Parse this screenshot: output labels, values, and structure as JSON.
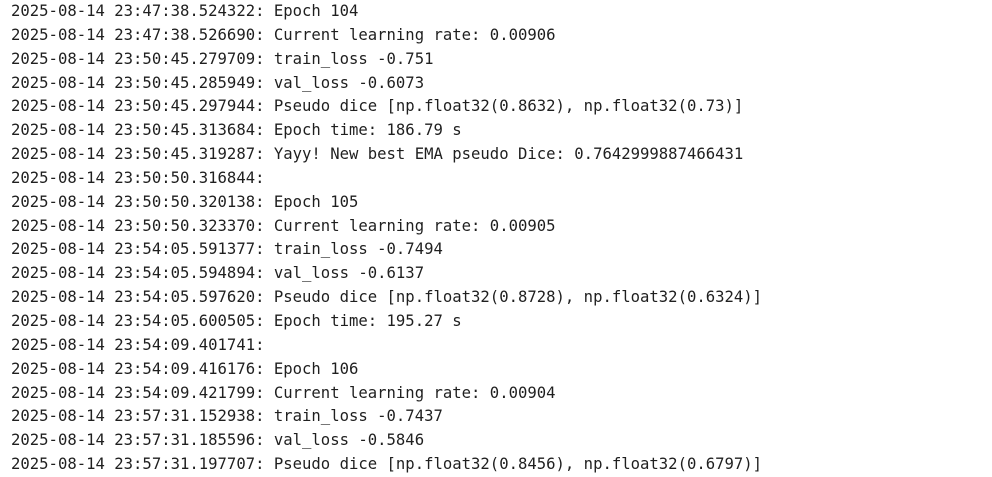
{
  "log": {
    "lines": [
      "2025-08-14 23:47:38.524322: Epoch 104",
      "2025-08-14 23:47:38.526690: Current learning rate: 0.00906",
      "2025-08-14 23:50:45.279709: train_loss -0.751",
      "2025-08-14 23:50:45.285949: val_loss -0.6073",
      "2025-08-14 23:50:45.297944: Pseudo dice [np.float32(0.8632), np.float32(0.73)]",
      "2025-08-14 23:50:45.313684: Epoch time: 186.79 s",
      "2025-08-14 23:50:45.319287: Yayy! New best EMA pseudo Dice: 0.7642999887466431",
      "2025-08-14 23:50:50.316844: ",
      "2025-08-14 23:50:50.320138: Epoch 105",
      "2025-08-14 23:50:50.323370: Current learning rate: 0.00905",
      "2025-08-14 23:54:05.591377: train_loss -0.7494",
      "2025-08-14 23:54:05.594894: val_loss -0.6137",
      "2025-08-14 23:54:05.597620: Pseudo dice [np.float32(0.8728), np.float32(0.6324)]",
      "2025-08-14 23:54:05.600505: Epoch time: 195.27 s",
      "2025-08-14 23:54:09.401741: ",
      "2025-08-14 23:54:09.416176: Epoch 106",
      "2025-08-14 23:54:09.421799: Current learning rate: 0.00904",
      "2025-08-14 23:57:31.152938: train_loss -0.7437",
      "2025-08-14 23:57:31.185596: val_loss -0.5846",
      "2025-08-14 23:57:31.197707: Pseudo dice [np.float32(0.8456), np.float32(0.6797)]"
    ]
  }
}
